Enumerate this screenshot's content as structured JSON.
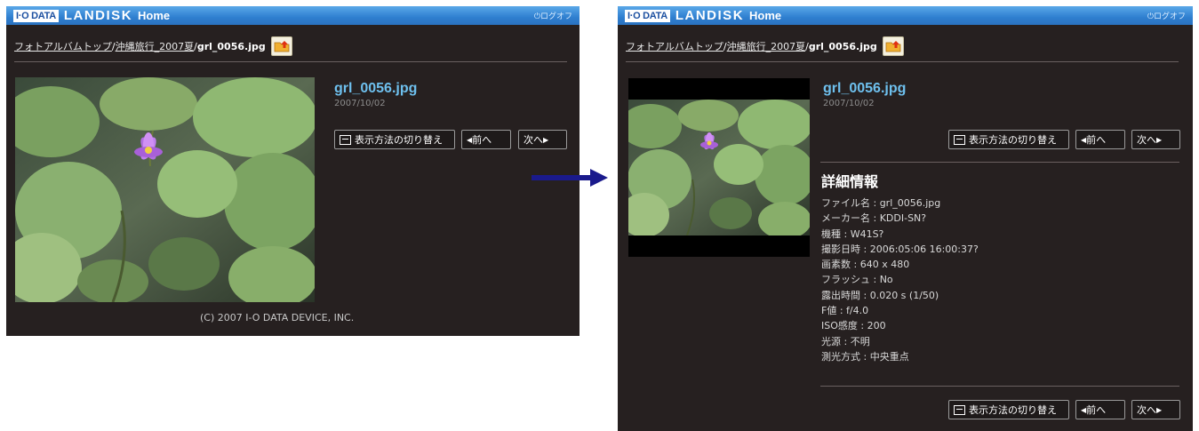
{
  "header": {
    "logo_box": "I·O DATA",
    "logo_landisk": "LANDISK",
    "logo_home": "Home",
    "logoff": "ログオフ"
  },
  "breadcrumb": {
    "top": "フォトアルバムトップ",
    "sep": "/",
    "album": "沖縄旅行_2007夏",
    "file": "grl_0056.jpg"
  },
  "photo": {
    "title": "grl_0056.jpg",
    "date": "2007/10/02"
  },
  "buttons": {
    "toggle": "表示方法の切り替え",
    "prev": "前へ",
    "next": "次へ"
  },
  "footer": {
    "copyright": "(C) 2007 I-O DATA DEVICE, INC."
  },
  "details": {
    "title": "詳細情報",
    "items": [
      "ファイル名 : grl_0056.jpg",
      "メーカー名 : KDDI-SN?",
      "機種 : W41S?",
      "撮影日時 : 2006:05:06 16:00:37?",
      "画素数 : 640 x 480",
      "フラッシュ : No",
      "露出時間 : 0.020 s (1/50)",
      "F値 : f/4.0",
      "ISO感度 : 200",
      "光源 : 不明",
      "測光方式 : 中央重点"
    ]
  },
  "colors": {
    "panel_bg": "#262020",
    "header_blue": "#2f7fd0",
    "title_blue": "#6ec0ee",
    "arrow": "#1a1a8c"
  }
}
